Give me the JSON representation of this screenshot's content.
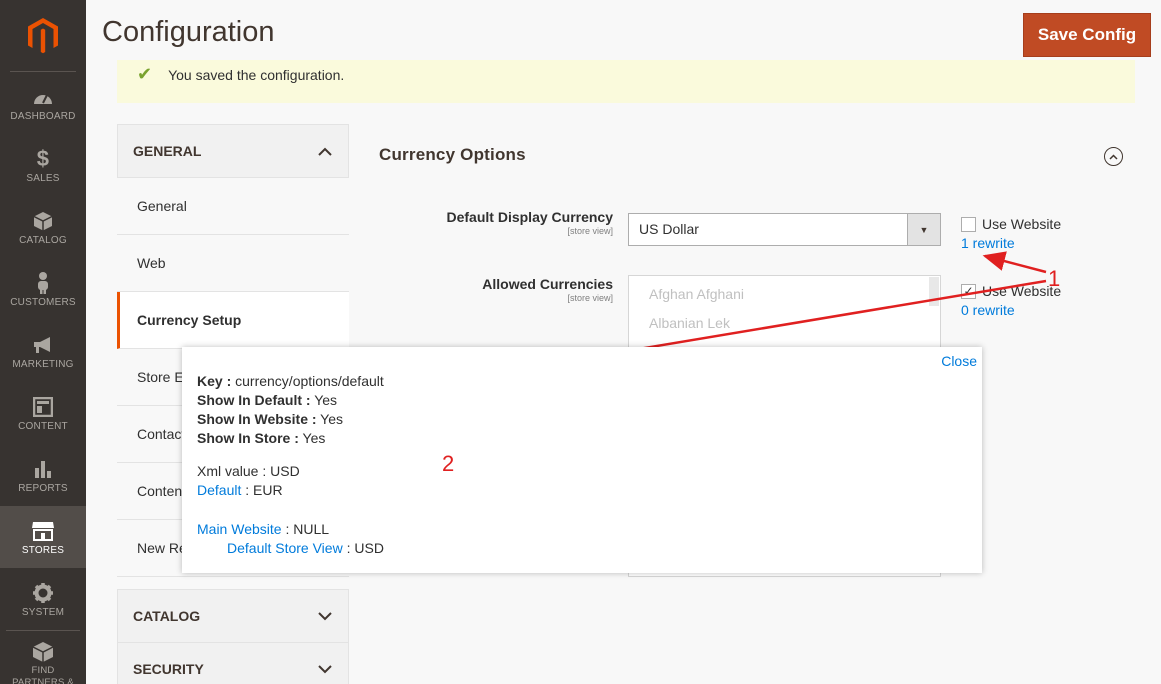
{
  "sidebar": {
    "items": [
      {
        "label": "DASHBOARD",
        "icon": "dashboard-icon"
      },
      {
        "label": "SALES",
        "icon": "dollar-icon"
      },
      {
        "label": "CATALOG",
        "icon": "cube-icon"
      },
      {
        "label": "CUSTOMERS",
        "icon": "person-icon"
      },
      {
        "label": "MARKETING",
        "icon": "megaphone-icon"
      },
      {
        "label": "CONTENT",
        "icon": "layout-icon"
      },
      {
        "label": "REPORTS",
        "icon": "bar-chart-icon"
      },
      {
        "label": "STORES",
        "icon": "store-icon"
      },
      {
        "label": "SYSTEM",
        "icon": "gear-icon"
      },
      {
        "label": "FIND PARTNERS & EXTENSIONS",
        "icon": "box-icon"
      }
    ]
  },
  "header": {
    "title": "Configuration",
    "save_label": "Save Config"
  },
  "message": {
    "text": "You saved the configuration."
  },
  "tabs": {
    "general_head": "GENERAL",
    "general_items": [
      "General",
      "Web",
      "Currency Setup",
      "Store Email Addresses",
      "Contacts",
      "Content Management",
      "New Relic Reporting"
    ],
    "catalog_head": "CATALOG",
    "security_head": "SECURITY"
  },
  "section": {
    "title": "Currency Options",
    "default_display": {
      "label": "Default Display Currency",
      "scope": "[store view]",
      "value": "US Dollar",
      "use_website": "Use Website",
      "rewrite": "1 rewrite"
    },
    "allowed": {
      "label": "Allowed Currencies",
      "scope": "[store view]",
      "options": [
        "Afghan Afghani",
        "Albanian Lek"
      ],
      "use_website": "Use Website",
      "rewrite": "0 rewrite"
    }
  },
  "annotations": {
    "one": "1",
    "two": "2"
  },
  "popup": {
    "close": "Close",
    "key_label": "Key :",
    "key_value": "currency/options/default",
    "default_label": "Show In Default :",
    "default_value": "Yes",
    "website_label": "Show In Website :",
    "website_value": "Yes",
    "store_label": "Show In Store :",
    "store_value": "Yes",
    "xml_text": "Xml value : USD",
    "default_link": "Default",
    "default_text": " : EUR",
    "main_website_link": "Main Website",
    "main_website_text": " : NULL",
    "store_view_link": "Default Store View",
    "store_view_text": " : USD"
  },
  "colors": {
    "accent": "#eb5202",
    "save_button": "#c04b24",
    "link": "#007bdb",
    "annotation": "#e02020",
    "sidebar": "#373330"
  }
}
